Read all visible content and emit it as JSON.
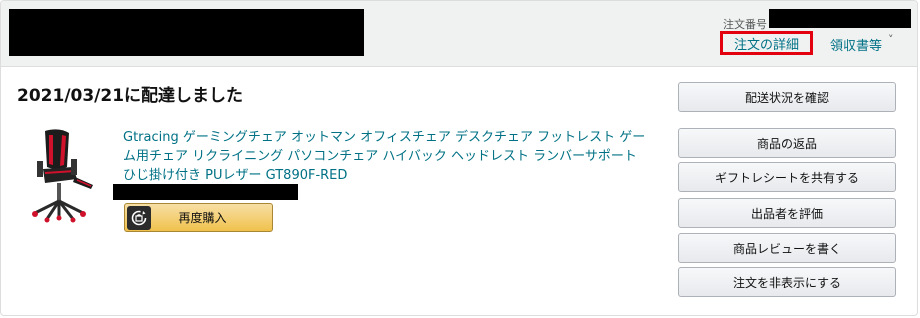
{
  "header": {
    "order_number_label": "注文番号",
    "order_details_link": "注文の詳細",
    "receipt_link": "領収書等",
    "receipt_caret": "˅"
  },
  "shipment": {
    "delivery_status": "2021/03/21に配達しました",
    "product_title": "Gtracing ゲーミングチェア オットマン オフィスチェア デスクチェア フットレスト ゲーム用チェア リクライニング パソコンチェア ハイバック ヘッドレスト ランバーサポート ひじ掛け付き PUレザー GT890F-RED",
    "buy_again_label": "再度購入",
    "buy_again_icon": "repeat-icon",
    "product_image": "gaming-chair-red"
  },
  "actions": {
    "track_package": "配送状況を確認",
    "return_items": "商品の返品",
    "share_gift_receipt": "ギフトレシートを共有する",
    "seller_feedback": "出品者を評価",
    "write_review": "商品レビューを書く",
    "archive_order": "注文を非表示にする"
  },
  "colors": {
    "link": "#007185",
    "highlight_border": "#e3000f",
    "primary_button": "#f0c14b",
    "header_bg": "#f0f2f2"
  }
}
